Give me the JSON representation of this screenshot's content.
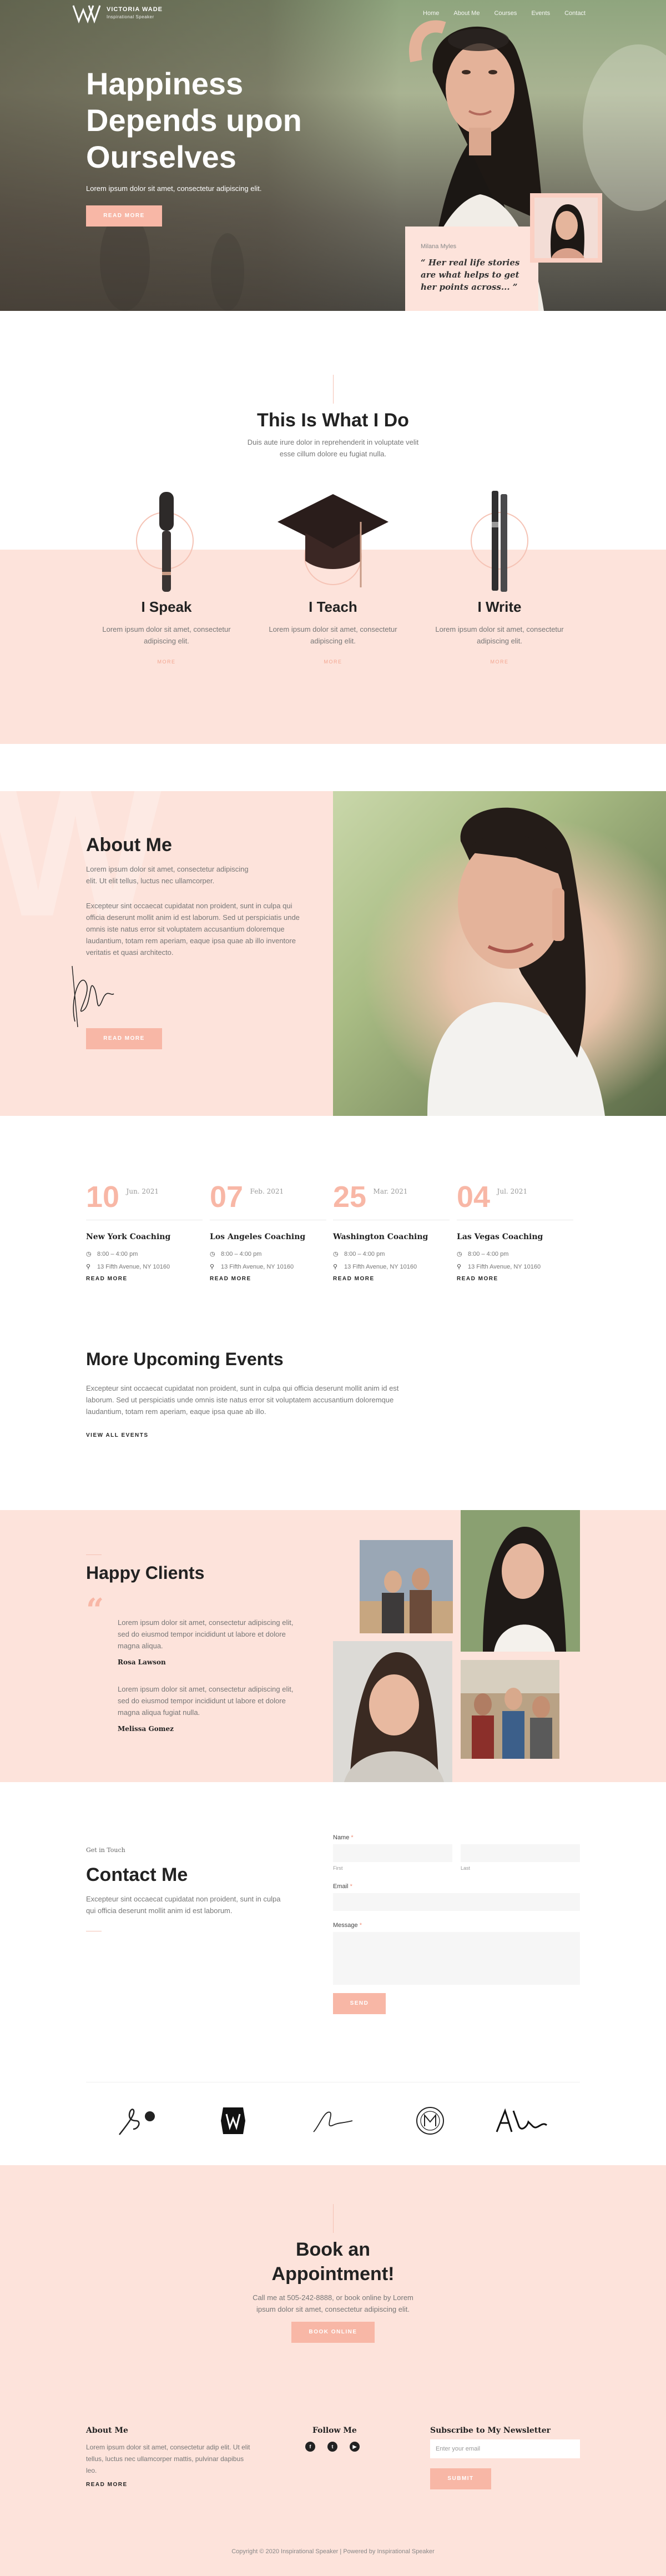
{
  "nav": {
    "brand": "VICTORIA WADE",
    "tagline": "Inspirational Speaker",
    "items": [
      "Home",
      "About Me",
      "Courses",
      "Events",
      "Contact"
    ]
  },
  "hero": {
    "title": "Happiness Depends upon Ourselves",
    "subtitle": "Lorem ipsum dolor sit amet, consectetur adipiscing elit.",
    "button": "READ MORE",
    "quote_name": "Milana Myles",
    "quote_text": "“ Her real life stories are what helps to get her points across... ”"
  },
  "services": {
    "title": "This Is What I Do",
    "subtitle": "Duis aute irure dolor in reprehenderit in voluptate velit esse cillum dolore eu fugiat nulla.",
    "items": [
      {
        "title": "I Speak",
        "text": "Lorem ipsum dolor sit amet, consectetur adipiscing elit.",
        "more": "MORE"
      },
      {
        "title": "I Teach",
        "text": "Lorem ipsum dolor sit amet, consectetur adipiscing elit.",
        "more": "MORE"
      },
      {
        "title": "I Write",
        "text": "Lorem ipsum dolor sit amet, consectetur adipiscing elit.",
        "more": "MORE"
      }
    ]
  },
  "about": {
    "title": "About Me",
    "p1": "Lorem ipsum dolor sit amet, consectetur adipiscing elit. Ut elit tellus, luctus nec ullamcorper.",
    "p2": "Excepteur sint occaecat cupidatat non proident, sunt in culpa qui officia deserunt mollit anim id est laborum. Sed ut perspiciatis unde omnis iste natus error sit voluptatem accusantium doloremque laudantium, totam rem aperiam, eaque ipsa quae ab illo inventore veritatis et quasi architecto.",
    "button": "READ MORE"
  },
  "events": {
    "items": [
      {
        "day": "10",
        "month": "Jun. 2021",
        "title": "New York Coaching",
        "time": "8:00 – 4:00 pm",
        "address": "13 Fifth Avenue, NY 10160",
        "read": "READ MORE"
      },
      {
        "day": "07",
        "month": "Feb. 2021",
        "title": "Los Angeles Coaching",
        "time": "8:00 – 4:00 pm",
        "address": "13 Fifth Avenue, NY 10160",
        "read": "READ MORE"
      },
      {
        "day": "25",
        "month": "Mar. 2021",
        "title": "Washington Coaching",
        "time": "8:00 – 4:00 pm",
        "address": "13 Fifth Avenue, NY 10160",
        "read": "READ MORE"
      },
      {
        "day": "04",
        "month": "Jul. 2021",
        "title": "Las Vegas Coaching",
        "time": "8:00 – 4:00 pm",
        "address": "13 Fifth Avenue, NY 10160",
        "read": "READ MORE"
      }
    ],
    "more_title": "More Upcoming Events",
    "more_text": "Excepteur sint occaecat cupidatat non proident, sunt in culpa qui officia deserunt mollit anim id est laborum. Sed ut perspiciatis unde omnis iste natus error sit voluptatem accusantium doloremque laudantium, totam rem aperiam, eaque ipsa quae ab illo.",
    "view_all": "VIEW ALL EVENTS"
  },
  "clients": {
    "title": "Happy Clients",
    "testimonials": [
      {
        "text": "Lorem ipsum dolor sit amet, consectetur adipiscing elit, sed do eiusmod tempor incididunt ut labore et dolore magna aliqua.",
        "author": "Rosa Lawson"
      },
      {
        "text": "Lorem ipsum dolor sit amet, consectetur adipiscing elit, sed do eiusmod tempor incididunt ut labore et dolore magna aliqua fugiat nulla.",
        "author": "Melissa Gomez"
      }
    ]
  },
  "contact": {
    "small": "Get in Touch",
    "title": "Contact Me",
    "text": "Excepteur sint occaecat cupidatat non proident, sunt in culpa qui officia deserunt mollit anim id est laborum.",
    "name_label": "Name",
    "first_hint": "First",
    "last_hint": "Last",
    "email_label": "Email",
    "message_label": "Message",
    "required": "*",
    "button": "SEND"
  },
  "book": {
    "title": "Book an Appointment!",
    "text": "Call me at 505-242-8888, or book online by Lorem ipsum dolor sit amet, consectetur adipiscing elit.",
    "button": "BOOK ONLINE"
  },
  "footer": {
    "about_title": "About Me",
    "about_text": "Lorem ipsum dolor sit amet, consectetur adip elit. Ut elit tellus, luctus nec ullamcorper mattis, pulvinar dapibus leo.",
    "about_read": "READ MORE",
    "follow_title": "Follow Me",
    "social_icons": [
      "facebook-icon",
      "twitter-icon",
      "youtube-icon"
    ],
    "newsletter_title": "Subscribe to My Newsletter",
    "newsletter_placeholder": "Enter your email",
    "newsletter_button": "SUBMIT",
    "copyright": "Copyright © 2020 Inspirational Speaker | Powered by Inspirational Speaker"
  },
  "colors": {
    "accent": "#f8b7a6",
    "peach": "#fde3db",
    "text_dark": "#222222"
  }
}
